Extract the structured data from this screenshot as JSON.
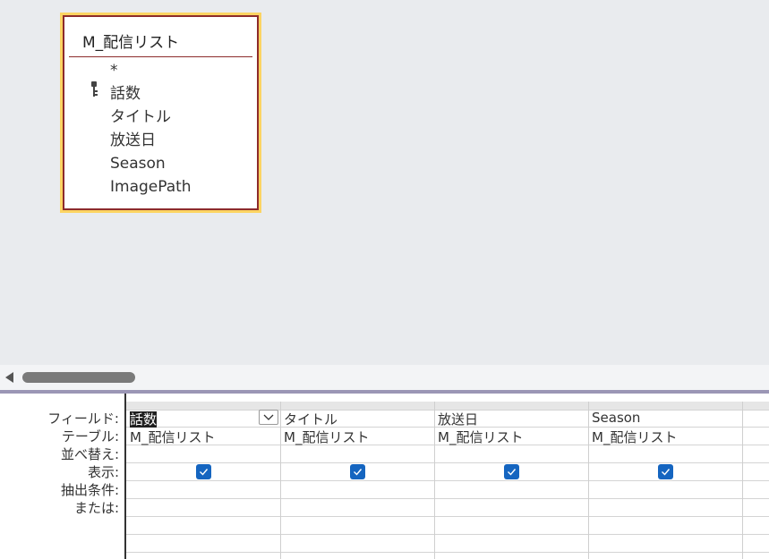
{
  "table": {
    "title": "M_配信リスト",
    "fields": [
      "*",
      "話数",
      "タイトル",
      "放送日",
      "Season",
      "ImagePath"
    ],
    "primary_key_field": "話数"
  },
  "grid": {
    "row_labels": [
      "フィールド:",
      "テーブル:",
      "並べ替え:",
      "表示:",
      "抽出条件:",
      "または:"
    ],
    "columns": [
      {
        "field": "話数",
        "table": "M_配信リスト",
        "show": true
      },
      {
        "field": "タイトル",
        "table": "M_配信リスト",
        "show": true
      },
      {
        "field": "放送日",
        "table": "M_配信リスト",
        "show": true
      },
      {
        "field": "Season",
        "table": "M_配信リスト",
        "show": true
      }
    ]
  },
  "icons": {
    "key": "key-icon",
    "dropdown": "chevron-down-icon",
    "check": "check-icon",
    "scroll_left": "arrow-left-icon"
  },
  "colors": {
    "table_highlight": "#fcd462",
    "table_border": "#8d2b2b",
    "checkbox": "#1565c0",
    "splitter": "#9b96b5"
  }
}
